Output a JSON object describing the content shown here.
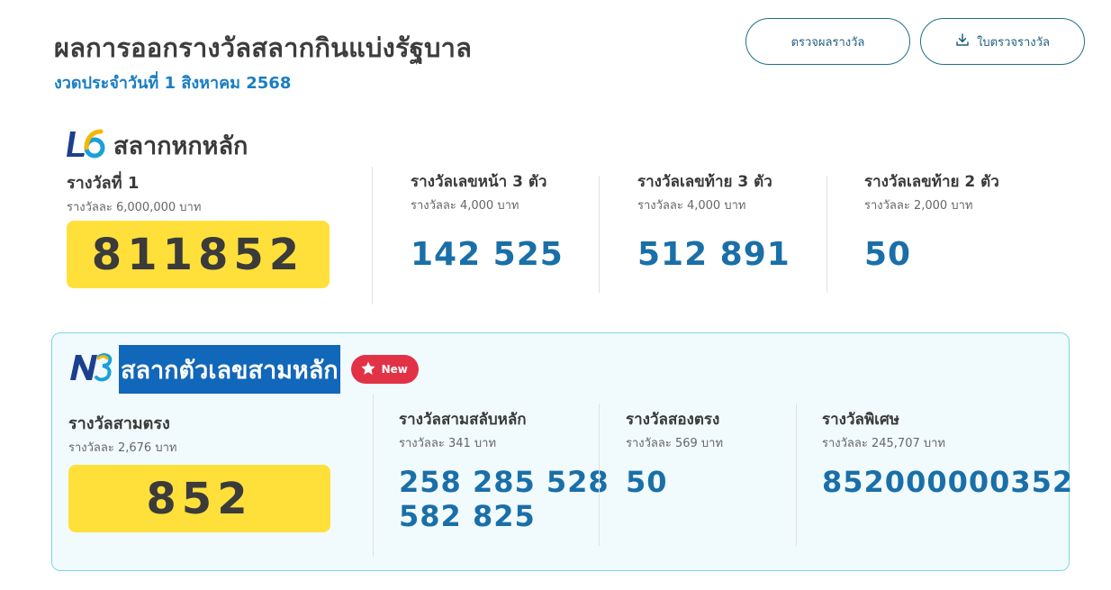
{
  "header": {
    "title": "ผลการออกรางวัลสลากกินแบ่งรัฐบาล",
    "subtitle": "งวดประจำวันที่ 1 สิงหาคม 2568",
    "check_button": "ตรวจผลรางวัล",
    "download_button": "ใบตรวจรางวัล"
  },
  "six_digit": {
    "title": "สลากหกหลัก",
    "first": {
      "name": "รางวัลที่ 1",
      "amount": "รางวัลละ 6,000,000 บาท",
      "number": "811852"
    },
    "front3": {
      "name": "รางวัลเลขหน้า 3 ตัว",
      "amount": "รางวัลละ 4,000 บาท",
      "numbers": "142  525"
    },
    "last3": {
      "name": "รางวัลเลขท้าย 3 ตัว",
      "amount": "รางวัลละ 4,000 บาท",
      "numbers": "512  891"
    },
    "last2": {
      "name": "รางวัลเลขท้าย 2 ตัว",
      "amount": "รางวัลละ 2,000 บาท",
      "numbers": "50"
    }
  },
  "three_digit": {
    "title": "สลากตัวเลขสามหลัก",
    "badge": "New",
    "straight3": {
      "name": "รางวัลสามตรง",
      "amount": "รางวัลละ 2,676 บาท",
      "number": "852"
    },
    "shuffle3": {
      "name": "รางวัลสามสลับหลัก",
      "amount": "รางวัลละ 341 บาท",
      "line1": "258 285 528",
      "line2": "582 825"
    },
    "straight2": {
      "name": "รางวัลสองตรง",
      "amount": "รางวัลละ 569 บาท",
      "numbers": "50"
    },
    "special": {
      "name": "รางวัลพิเศษ",
      "amount": "รางวัลละ 245,707 บาท",
      "numbers": "852000000352"
    }
  },
  "colors": {
    "accent": "#1a6fa8",
    "highlight": "#ffe03a",
    "badge": "#e23246",
    "panel_bg": "#f1fbfd"
  }
}
